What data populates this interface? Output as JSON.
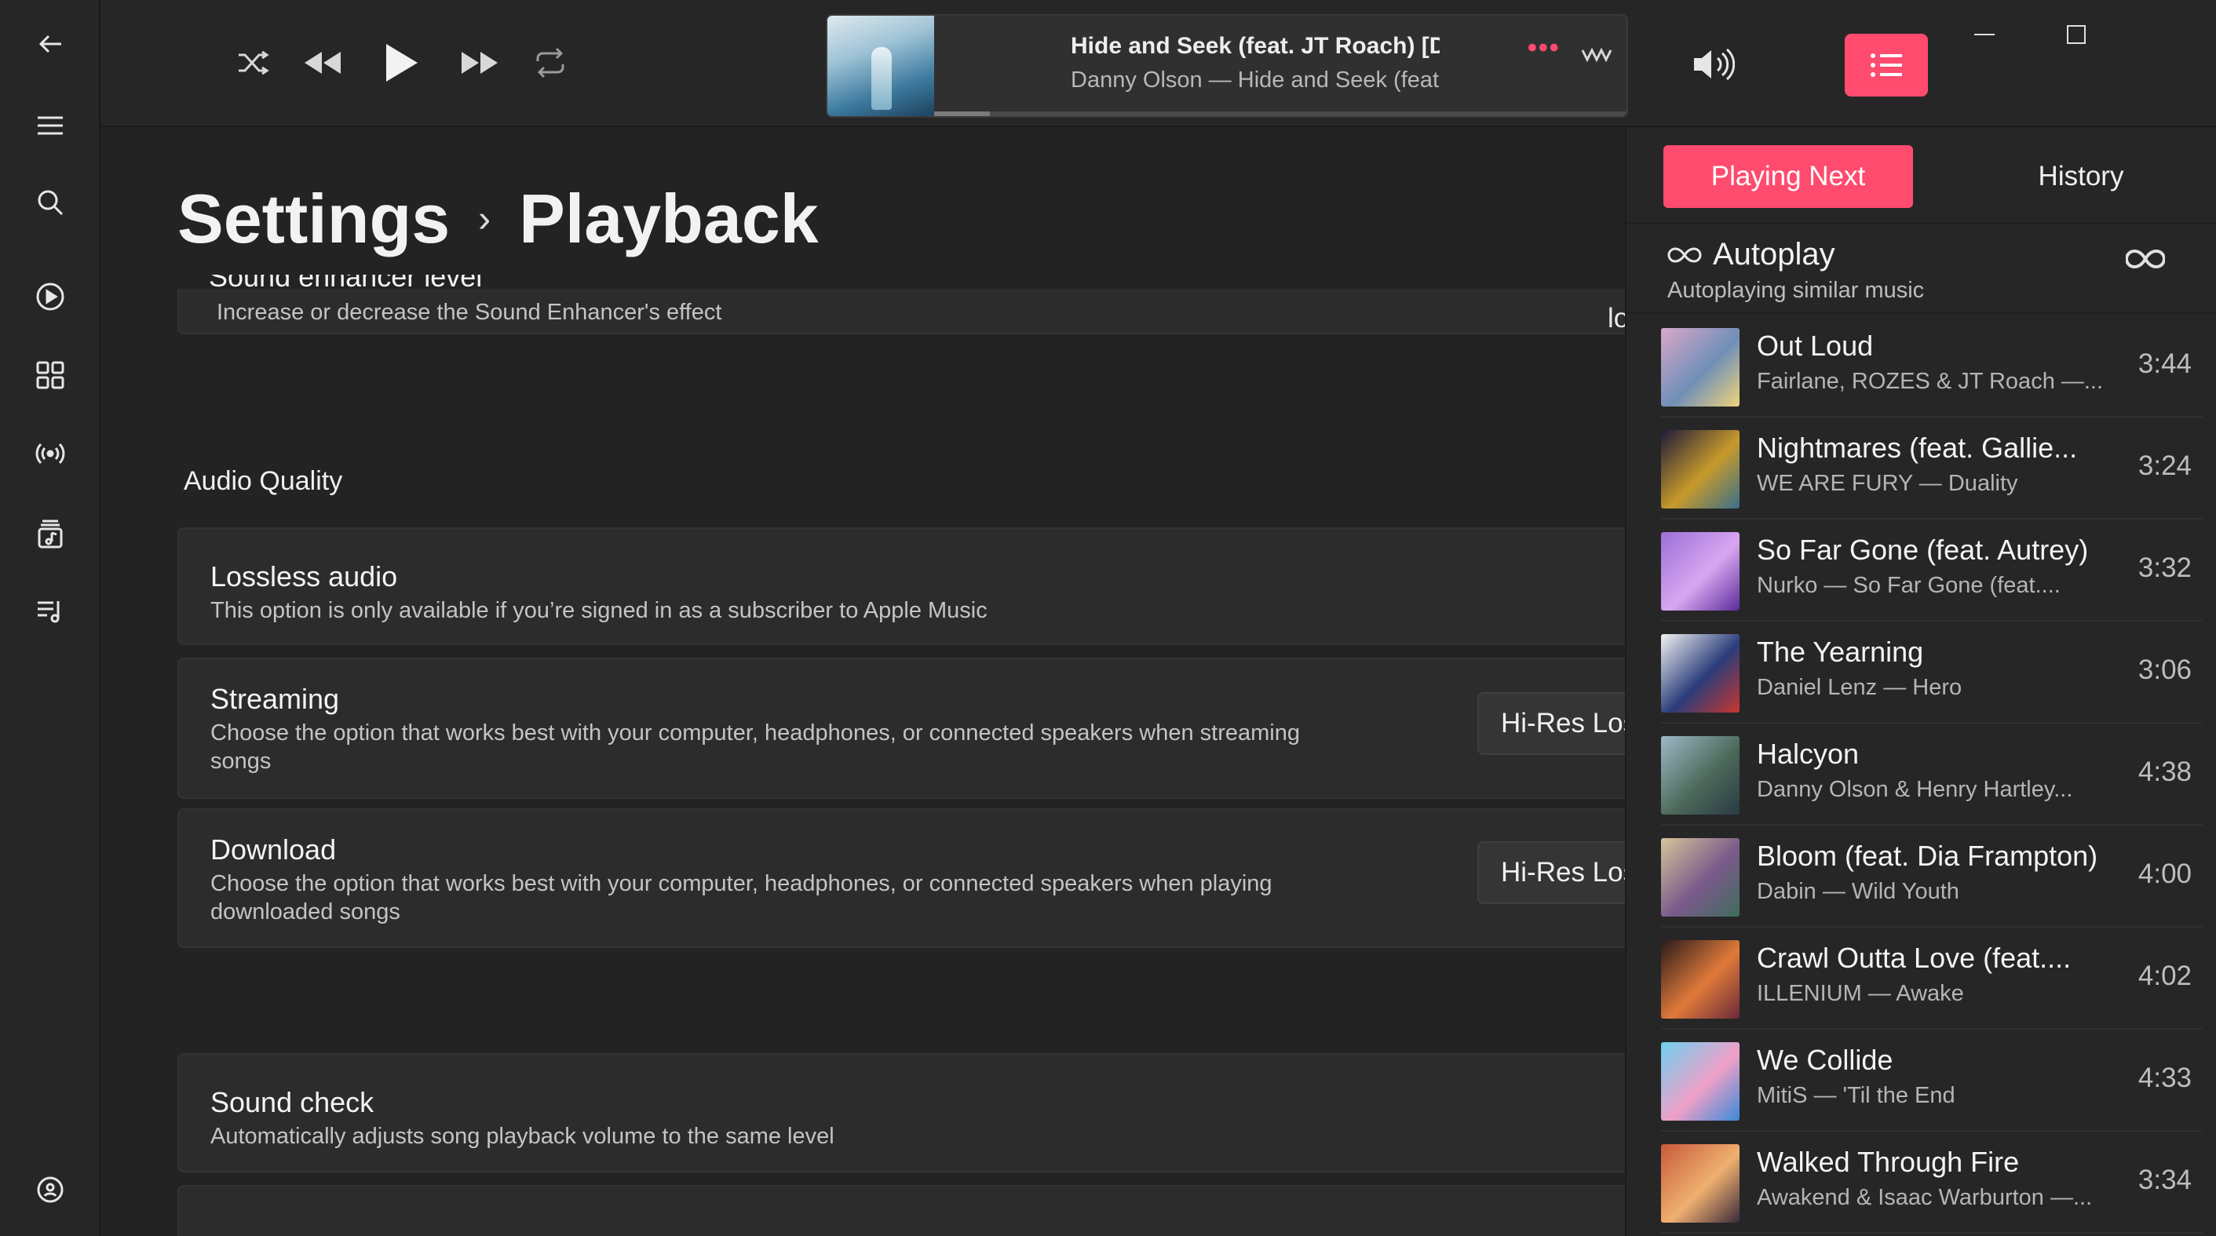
{
  "topbar": {
    "track_title": "Hide and Seek (feat. JT Roach) [Don D",
    "track_subtitle": "Danny Olson — Hide and Seek (feat. JT",
    "more_label": "•••",
    "progress_fraction": 0.08
  },
  "breadcrumb": {
    "root": "Settings",
    "separator": "›",
    "current": "Playback"
  },
  "settings": {
    "sound_enhancer": {
      "title": "Sound enhancer level",
      "description": "Increase or decrease the Sound Enhancer's effect",
      "value": "low"
    },
    "audio_quality_label": "Audio Quality",
    "lossless": {
      "title": "Lossless audio",
      "description": "This option is only available if you’re signed in as a subscriber to Apple Music"
    },
    "streaming": {
      "title": "Streaming",
      "description": "Choose the option that works best with your computer, headphones, or connected speakers when streaming songs",
      "value": "Hi-Res Lossless"
    },
    "download": {
      "title": "Download",
      "description": "Choose the option that works best with your computer, headphones, or connected speakers when playing downloaded songs",
      "value": "Hi-Res Lossless"
    },
    "sound_check": {
      "title": "Sound check",
      "description": "Automatically adjusts song playback volume to the same level"
    }
  },
  "queue": {
    "tabs": [
      "Playing Next",
      "History"
    ],
    "autoplay_title": "Autoplay",
    "autoplay_subtitle": "Autoplaying similar music",
    "tracks": [
      {
        "title": "Out Loud",
        "subtitle": "Fairlane, ROZES & JT Roach —...",
        "duration": "3:44",
        "art": [
          "#d9a8c9",
          "#6f8fb8",
          "#f0d47a"
        ]
      },
      {
        "title": "Nightmares (feat. Gallie...",
        "subtitle": "WE ARE FURY — Duality",
        "duration": "3:24",
        "art": [
          "#1e1a3a",
          "#c79a2b",
          "#3a6f8a"
        ]
      },
      {
        "title": "So Far Gone (feat. Autrey)",
        "subtitle": "Nurko — So Far Gone (feat....",
        "duration": "3:32",
        "art": [
          "#9b6fd8",
          "#d9a7f0",
          "#5a2c9a"
        ]
      },
      {
        "title": "The Yearning",
        "subtitle": "Daniel Lenz — Hero",
        "duration": "3:06",
        "art": [
          "#f2f2f2",
          "#2a3d7a",
          "#c9362f"
        ]
      },
      {
        "title": "Halcyon",
        "subtitle": "Danny Olson & Henry Hartley...",
        "duration": "4:38",
        "art": [
          "#9fb8c8",
          "#4d6a5a",
          "#2a3a44"
        ]
      },
      {
        "title": "Bloom (feat. Dia Frampton)",
        "subtitle": "Dabin — Wild Youth",
        "duration": "4:00",
        "art": [
          "#d7c49a",
          "#7a5a8a",
          "#3e6d5c"
        ]
      },
      {
        "title": "Crawl Outta Love (feat....",
        "subtitle": "ILLENIUM — Awake",
        "duration": "4:02",
        "art": [
          "#2a1a1a",
          "#e07a3a",
          "#6a2a3a"
        ]
      },
      {
        "title": "We Collide",
        "subtitle": "MitiS — 'Til the End",
        "duration": "4:33",
        "art": [
          "#6fd0f0",
          "#f0a0c8",
          "#3a8ad8"
        ]
      },
      {
        "title": "Walked Through Fire",
        "subtitle": "Awakend & Isaac Warburton —...",
        "duration": "3:34",
        "art": [
          "#c85a3a",
          "#f0b070",
          "#3a2a3a"
        ]
      }
    ]
  },
  "colors": {
    "accent": "#ff4b6e",
    "background": "#232324",
    "card": "#2c2c2d"
  },
  "icons": {
    "rail": [
      "back-arrow-icon",
      "menu-icon",
      "search-icon",
      "play-circle-icon",
      "grid-icon",
      "radio-icon",
      "library-icon",
      "playlist-icon",
      "account-icon"
    ],
    "transport": [
      "shuffle-icon",
      "previous-icon",
      "play-icon",
      "next-icon",
      "repeat-icon"
    ]
  }
}
